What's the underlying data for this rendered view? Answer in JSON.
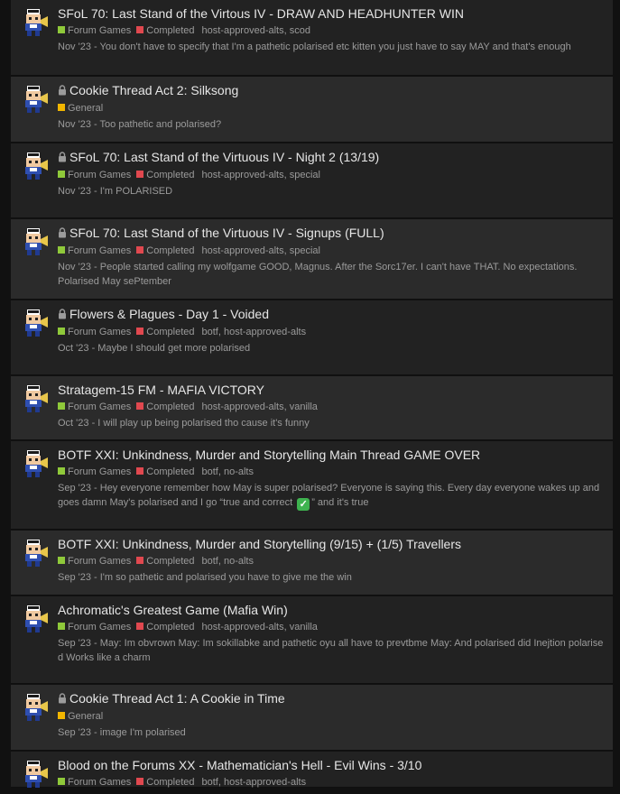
{
  "colors": {
    "forum_games": "#8fc93a",
    "completed": "#e0484f",
    "general": "#f2b600"
  },
  "topics": [
    {
      "title": "SFoL 70: Last Stand of the Virtous IV - DRAW AND HEADHUNTER WIN",
      "locked": false,
      "categories": [
        {
          "label": "Forum Games",
          "color": "green"
        },
        {
          "label": "Completed",
          "color": "red"
        }
      ],
      "tags": "host-approved-alts, scod",
      "date": "Nov '23",
      "excerpt": "You don't have to specify that I'm a pathetic polarised etc kitten you just have to say MAY and that's enough"
    },
    {
      "title": "Cookie Thread Act 2: Silksong",
      "locked": true,
      "categories": [
        {
          "label": "General",
          "color": "yellow"
        }
      ],
      "tags": "",
      "date": "Nov '23",
      "excerpt": "Too pathetic and polarised?"
    },
    {
      "title": "SFoL 70: Last Stand of the Virtuous IV - Night 2 (13/19)",
      "locked": true,
      "categories": [
        {
          "label": "Forum Games",
          "color": "green"
        },
        {
          "label": "Completed",
          "color": "red"
        }
      ],
      "tags": "host-approved-alts, special",
      "date": "Nov '23",
      "excerpt": "I'm POLARISED"
    },
    {
      "title": "SFoL 70: Last Stand of the Virtuous IV - Signups (FULL)",
      "locked": true,
      "categories": [
        {
          "label": "Forum Games",
          "color": "green"
        },
        {
          "label": "Completed",
          "color": "red"
        }
      ],
      "tags": "host-approved-alts, special",
      "date": "Nov '23",
      "excerpt": "People started calling my wolfgame GOOD, Magnus. After the Sorc17er. I can't have THAT. No expectations. Polarised May sePtember"
    },
    {
      "title": "Flowers & Plagues - Day 1 - Voided",
      "locked": true,
      "categories": [
        {
          "label": "Forum Games",
          "color": "green"
        },
        {
          "label": "Completed",
          "color": "red"
        }
      ],
      "tags": "botf, host-approved-alts",
      "date": "Oct '23",
      "excerpt": "Maybe I should get more polarised"
    },
    {
      "title": "Stratagem-15 FM - MAFIA VICTORY",
      "locked": false,
      "categories": [
        {
          "label": "Forum Games",
          "color": "green"
        },
        {
          "label": "Completed",
          "color": "red"
        }
      ],
      "tags": "host-approved-alts, vanilla",
      "date": "Oct '23",
      "excerpt": "I will play up being polarised tho cause it's funny"
    },
    {
      "title": "BOTF XXI: Unkindness, Murder and Storytelling Main Thread GAME OVER",
      "locked": false,
      "categories": [
        {
          "label": "Forum Games",
          "color": "green"
        },
        {
          "label": "Completed",
          "color": "red"
        }
      ],
      "tags": "botf, no-alts",
      "date": "Sep '23",
      "excerpt": "Hey everyone remember how May is super polarised? Everyone is saying this. Every day everyone wakes up and goes damn May's polarised and I go “true and correct",
      "excerpt_tail": "” and it's true",
      "has_check": true
    },
    {
      "title": "BOTF XXI: Unkindness, Murder and Storytelling (9/15) + (1/5) Travellers",
      "locked": false,
      "categories": [
        {
          "label": "Forum Games",
          "color": "green"
        },
        {
          "label": "Completed",
          "color": "red"
        }
      ],
      "tags": "botf, no-alts",
      "date": "Sep '23",
      "excerpt": "I'm so pathetic and polarised you have to give me the win"
    },
    {
      "title": "Achromatic's Greatest Game (Mafia Win)",
      "locked": false,
      "categories": [
        {
          "label": "Forum Games",
          "color": "green"
        },
        {
          "label": "Completed",
          "color": "red"
        }
      ],
      "tags": "host-approved-alts, vanilla",
      "date": "Sep '23",
      "excerpt": "May: Im obvrown May: Im sokillabke and pathetic oyu all have to prevtbme May: And polarised did Inejtion polarise d Works like a charm"
    },
    {
      "title": "Cookie Thread Act 1: A Cookie in Time",
      "locked": true,
      "categories": [
        {
          "label": "General",
          "color": "yellow"
        }
      ],
      "tags": "",
      "date": "Sep '23",
      "excerpt": "image I'm polarised"
    },
    {
      "title": "Blood on the Forums XX - Mathematician's Hell - Evil Wins - 3/10",
      "locked": false,
      "categories": [
        {
          "label": "Forum Games",
          "color": "green"
        },
        {
          "label": "Completed",
          "color": "red"
        }
      ],
      "tags": "botf, host-approved-alts",
      "date": "",
      "excerpt": ""
    }
  ]
}
